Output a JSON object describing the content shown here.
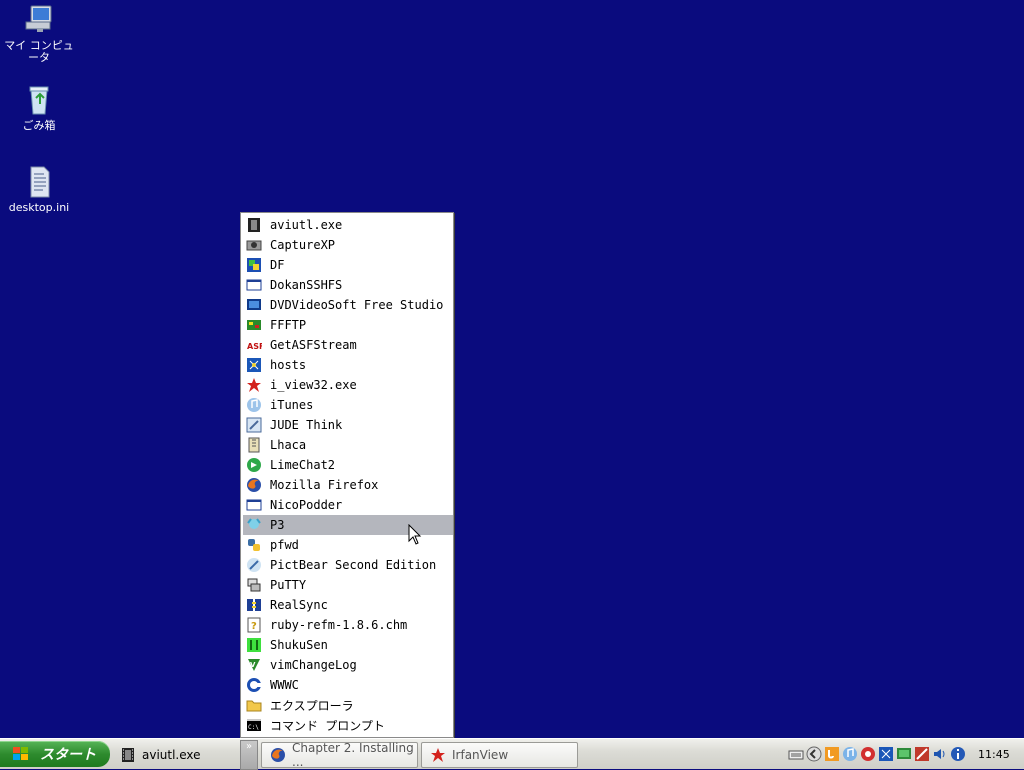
{
  "desktop": {
    "icons": [
      {
        "label": "マイ コンピュータ",
        "icon": "my-computer-icon"
      },
      {
        "label": "ごみ箱",
        "icon": "recycle-bin-icon"
      },
      {
        "label": "desktop.ini",
        "icon": "text-file-icon"
      }
    ]
  },
  "menu": {
    "hovered_item": "P3",
    "items": [
      {
        "label": "aviutl.exe",
        "icon": "film-icon"
      },
      {
        "label": "CaptureXP",
        "icon": "camera-icon"
      },
      {
        "label": "DF",
        "icon": "df-icon"
      },
      {
        "label": "DokanSSHFS",
        "icon": "window-icon"
      },
      {
        "label": "DVDVideoSoft Free Studio",
        "icon": "monitor-icon"
      },
      {
        "label": "FFFTP",
        "icon": "ffftp-icon"
      },
      {
        "label": "GetASFStream",
        "icon": "asf-icon"
      },
      {
        "label": "hosts",
        "icon": "hosts-file-icon"
      },
      {
        "label": "i_view32.exe",
        "icon": "irfanview-icon"
      },
      {
        "label": "iTunes",
        "icon": "music-note-icon"
      },
      {
        "label": "JUDE Think",
        "icon": "jude-icon"
      },
      {
        "label": "Lhaca",
        "icon": "archive-icon"
      },
      {
        "label": "LimeChat2",
        "icon": "chat-icon"
      },
      {
        "label": "Mozilla Firefox",
        "icon": "firefox-icon"
      },
      {
        "label": "NicoPodder",
        "icon": "window-icon"
      },
      {
        "label": "P3",
        "icon": "character-icon"
      },
      {
        "label": "pfwd",
        "icon": "python-icon"
      },
      {
        "label": "PictBear Second Edition",
        "icon": "paint-icon"
      },
      {
        "label": "PuTTY",
        "icon": "putty-icon"
      },
      {
        "label": "RealSync",
        "icon": "sync-icon"
      },
      {
        "label": "ruby-refm-1.8.6.chm",
        "icon": "help-file-icon"
      },
      {
        "label": "ShukuSen",
        "icon": "shukusen-icon"
      },
      {
        "label": "vimChangeLog",
        "icon": "vim-icon"
      },
      {
        "label": "WWWC",
        "icon": "wwwc-icon"
      },
      {
        "label": "エクスプローラ",
        "icon": "folder-icon"
      },
      {
        "label": "コマンド プロンプト",
        "icon": "cmd-icon"
      }
    ]
  },
  "taskbar": {
    "start_label": "スタート",
    "quick_launch_label": "aviutl.exe",
    "chevron": "»",
    "buttons": [
      {
        "label": "Chapter 2. Installing ...",
        "icon": "firefox-icon"
      },
      {
        "label": "IrfanView",
        "icon": "irfanview-icon"
      }
    ],
    "tray_icons": [
      "keyboard-icon",
      "back-arrow-icon",
      "java-icon",
      "itunes-icon",
      "lifebuoy-icon",
      "hosts-file-icon",
      "monitor-icon",
      "jude-icon",
      "volume-icon",
      "info-icon"
    ],
    "clock": "11:45"
  },
  "colors": {
    "desktop_bg": "#0a0b7e",
    "menu_hover": "#b4b6bd",
    "start_green": "#2e8b2e"
  }
}
